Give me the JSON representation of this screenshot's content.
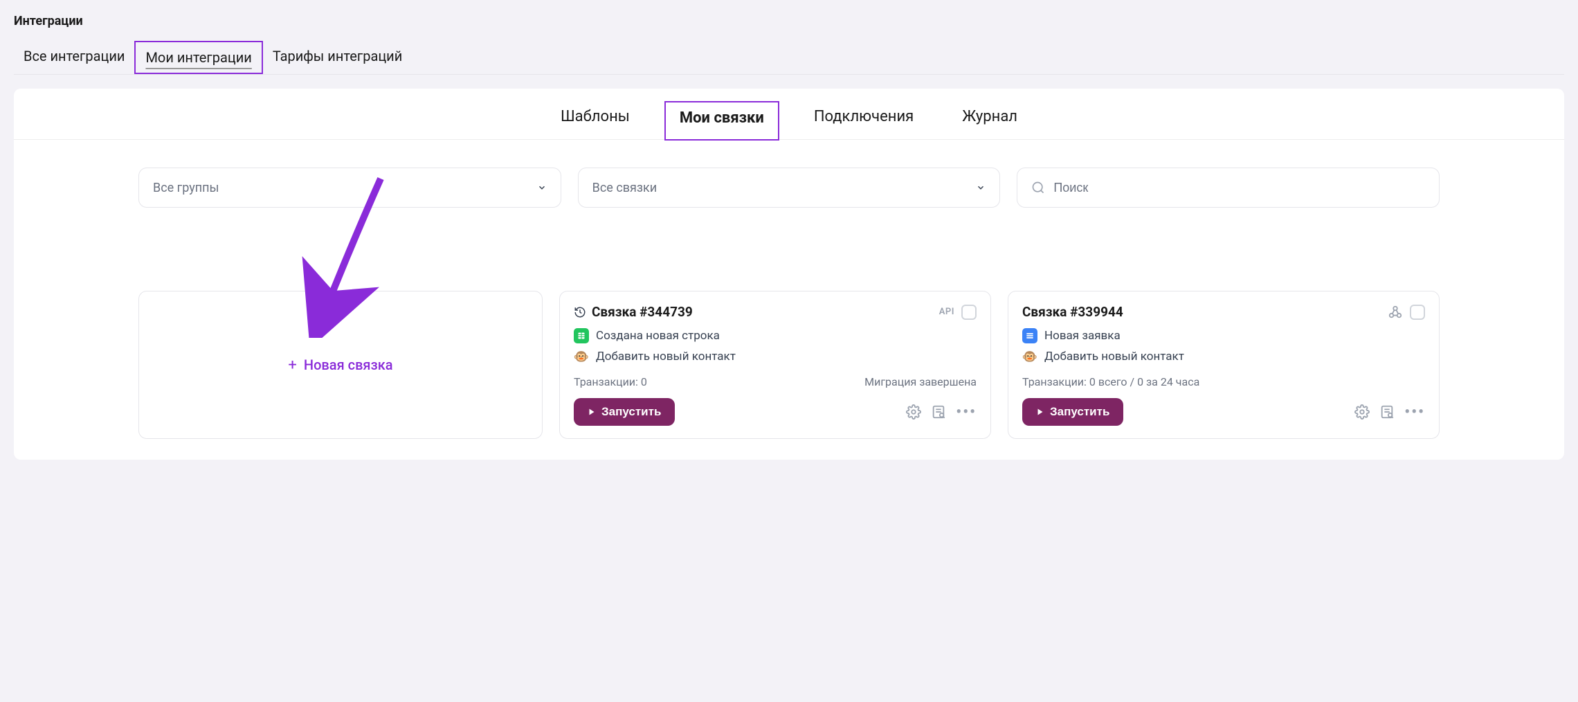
{
  "page_title": "Интеграции",
  "top_tabs": {
    "all": "Все интеграции",
    "my": "Мои интеграции",
    "tariffs": "Тарифы интеграций"
  },
  "sub_tabs": {
    "templates": "Шаблоны",
    "my_connections": "Мои связки",
    "connections": "Подключения",
    "journal": "Журнал"
  },
  "filters": {
    "groups": "Все группы",
    "connections": "Все связки",
    "search_placeholder": "Поиск"
  },
  "new_card_label": "Новая связка",
  "cards": [
    {
      "title": "Связка #344739",
      "badge": "API",
      "row1": "Создана новая строка",
      "row2": "Добавить новый контакт",
      "meta_left": "Транзакции: 0",
      "meta_right": "Миграция завершена",
      "run_label": "Запустить"
    },
    {
      "title": "Связка #339944",
      "badge": "webhook",
      "row1": "Новая заявка",
      "row2": "Добавить новый контакт",
      "meta_left": "Транзакции: 0 всего / 0 за 24 часа",
      "meta_right": "",
      "run_label": "Запустить"
    }
  ],
  "colors": {
    "accent": "#8a2bd9",
    "button": "#7e2563"
  }
}
